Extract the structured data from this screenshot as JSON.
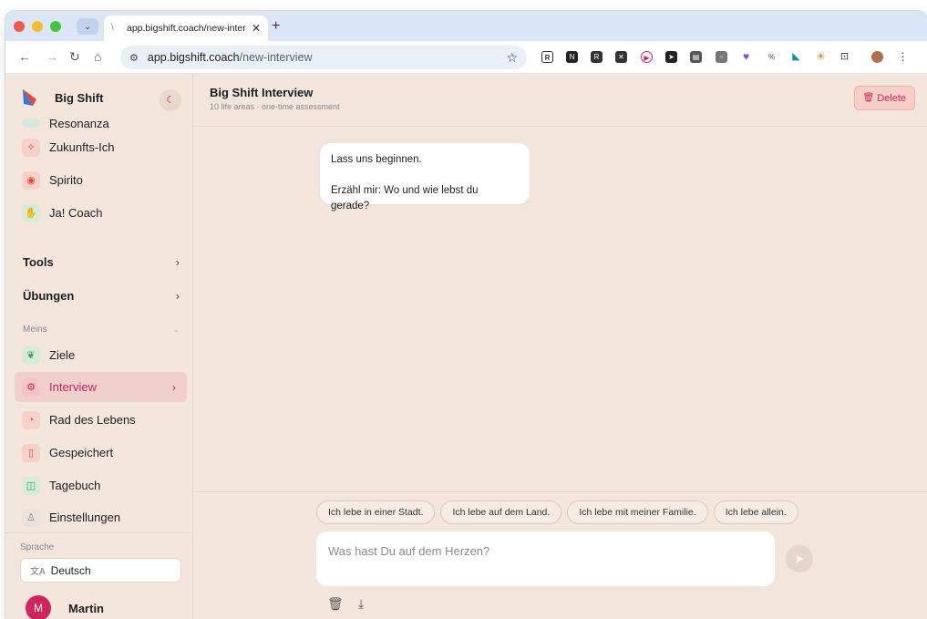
{
  "browser": {
    "tab_title": "app.bigshift.coach/new-inter",
    "url_host": "app.bigshift.coach",
    "url_path": "/new-interview"
  },
  "sidebar": {
    "brand": "Big Shift",
    "partial_item": "Resonanza",
    "items_top": [
      {
        "label": "Zukunfts-Ich",
        "icon": "sparkle-icon",
        "color": "#e8443a"
      },
      {
        "label": "Spirito",
        "icon": "eye-icon",
        "color": "#e8443a"
      },
      {
        "label": "Ja! Coach",
        "icon": "hand-icon",
        "color": "#3aa64b"
      }
    ],
    "sections": [
      {
        "label": "Tools"
      },
      {
        "label": "Übungen"
      }
    ],
    "group_label": "Meins",
    "items_mine": [
      {
        "label": "Ziele",
        "icon": "leaf-icon",
        "color": "#3aa64b"
      },
      {
        "label": "Interview",
        "icon": "gear-icon",
        "color": "#d1245c",
        "active": true
      },
      {
        "label": "Rad des Lebens",
        "icon": "pie-icon",
        "color": "#e8443a"
      },
      {
        "label": "Gespeichert",
        "icon": "bookmark-icon",
        "color": "#e8443a"
      },
      {
        "label": "Tagebuch",
        "icon": "book-icon",
        "color": "#3aa64b"
      },
      {
        "label": "Einstellungen",
        "icon": "user-icon",
        "color": "#888888"
      }
    ],
    "language_label": "Sprache",
    "language_value": "Deutsch",
    "user_initial": "M",
    "user_name": "Martin"
  },
  "main": {
    "title": "Big Shift Interview",
    "subtitle": "10 life areas · one-time assessment",
    "delete_label": "Delete",
    "message_line1": "Lass uns beginnen.",
    "message_line2": "Erzähl mir: Wo und wie lebst du gerade?",
    "suggestions": [
      "Ich lebe in einer Stadt.",
      "Ich lebe auf dem Land.",
      "Ich lebe mit meiner Familie.",
      "Ich lebe allein."
    ],
    "input_placeholder": "Was hast Du auf dem Herzen?"
  },
  "colors": {
    "accent": "#d1245c",
    "background": "#f3e6dc"
  }
}
